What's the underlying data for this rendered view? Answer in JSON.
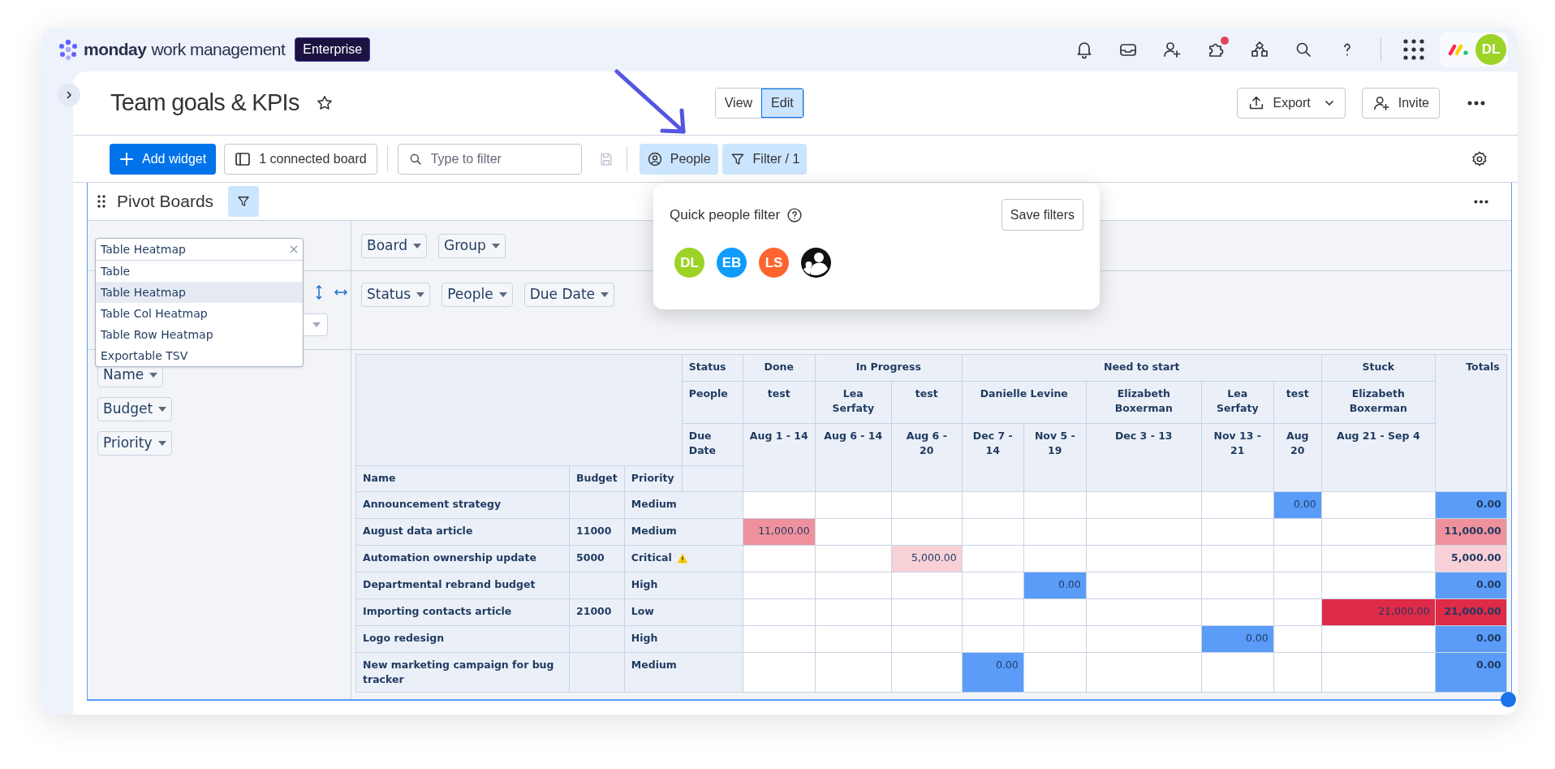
{
  "top_bar": {
    "brand": "monday",
    "product": "work management",
    "plan_badge": "Enterprise",
    "apps_notification": true,
    "avatar": {
      "initials": "DL",
      "color": "#9cd326"
    }
  },
  "board": {
    "title": "Team goals & KPIs",
    "view_modes": [
      {
        "label": "View",
        "selected": false
      },
      {
        "label": "Edit",
        "selected": true
      }
    ],
    "export_button": "Export",
    "invite_button": "Invite"
  },
  "toolbar": {
    "add_widget": "Add widget",
    "connected_boards": "1 connected board",
    "search": {
      "placeholder": "Type to filter"
    },
    "filters": [
      {
        "label": "People",
        "kind": "people",
        "active": true
      },
      {
        "label": "Filter / 1",
        "kind": "filter",
        "active": true
      }
    ]
  },
  "widget": {
    "title": "Pivot Boards",
    "renderer_select": {
      "value": "Table Heatmap",
      "options": [
        {
          "label": "Table",
          "selected": false
        },
        {
          "label": "Table Heatmap",
          "selected": true
        },
        {
          "label": "Table Col Heatmap",
          "selected": false
        },
        {
          "label": "Table Row Heatmap",
          "selected": false
        },
        {
          "label": "Exportable TSV",
          "selected": false
        }
      ]
    },
    "unused_attributes": [
      "Board",
      "Group"
    ],
    "column_attributes": [
      "Status",
      "People",
      "Due Date"
    ],
    "row_attributes": [
      "Name",
      "Budget",
      "Priority"
    ],
    "table": {
      "column_header_labels": [
        "Status",
        "People",
        "Due Date"
      ],
      "status_groups": [
        {
          "label": "Done",
          "people": [
            {
              "label": "test",
              "dates": [
                "Aug 1 - 14"
              ]
            }
          ]
        },
        {
          "label": "In Progress",
          "people": [
            {
              "label": "Lea Serfaty",
              "dates": [
                "Aug 6 - 14"
              ]
            },
            {
              "label": "test",
              "dates": [
                "Aug 6 - 20"
              ]
            }
          ]
        },
        {
          "label": "Need to start",
          "people": [
            {
              "label": "Danielle Levine",
              "dates": [
                "Dec 7 - 14",
                "Nov 5 - 19"
              ]
            },
            {
              "label": "Elizabeth Boxerman",
              "dates": [
                "Dec 3 - 13"
              ]
            },
            {
              "label": "Lea Serfaty",
              "dates": [
                "Nov 13 - 21"
              ]
            },
            {
              "label": "test",
              "dates": [
                "Aug 20"
              ]
            }
          ]
        },
        {
          "label": "Stuck",
          "people": [
            {
              "label": "Elizabeth Boxerman",
              "dates": [
                "Aug 21 - Sep 4"
              ]
            }
          ]
        }
      ],
      "totals_label": "Totals",
      "row_header_labels": [
        "Name",
        "Budget",
        "Priority"
      ],
      "rows": [
        {
          "name": "Announcement strategy",
          "priority": "Medium",
          "warning": false,
          "cells": [
            {
              "filled": false
            },
            {
              "filled": false
            },
            {
              "filled": false
            },
            {
              "filled": false
            },
            {
              "filled": false
            },
            {
              "filled": false
            },
            {
              "filled": false
            },
            {
              "filled": true,
              "text": "0.00",
              "color": "#5a9cf8"
            },
            {
              "filled": false
            }
          ],
          "total": {
            "text": "0.00",
            "color": "#5a9cf8"
          }
        },
        {
          "name": "August data article",
          "budget": "11000",
          "priority": "Medium",
          "warning": false,
          "cells": [
            {
              "filled": true,
              "text": "11,000.00",
              "color": "#ef919d"
            },
            {
              "filled": false
            },
            {
              "filled": false
            },
            {
              "filled": false
            },
            {
              "filled": false
            },
            {
              "filled": false
            },
            {
              "filled": false
            },
            {
              "filled": false
            },
            {
              "filled": false
            }
          ],
          "total": {
            "text": "11,000.00",
            "color": "#ef919d"
          }
        },
        {
          "name": "Automation ownership update",
          "budget": "5000",
          "priority": "Critical",
          "warning": true,
          "cells": [
            {
              "filled": false
            },
            {
              "filled": false
            },
            {
              "filled": true,
              "text": "5,000.00",
              "color": "#f8d1d7"
            },
            {
              "filled": false
            },
            {
              "filled": false
            },
            {
              "filled": false
            },
            {
              "filled": false
            },
            {
              "filled": false
            },
            {
              "filled": false
            }
          ],
          "total": {
            "text": "5,000.00",
            "color": "#f8d1d7"
          }
        },
        {
          "name": "Departmental rebrand budget",
          "priority": "High",
          "warning": false,
          "cells": [
            {
              "filled": false
            },
            {
              "filled": false
            },
            {
              "filled": false
            },
            {
              "filled": false
            },
            {
              "filled": true,
              "text": "0.00",
              "color": "#5a9cf8"
            },
            {
              "filled": false
            },
            {
              "filled": false
            },
            {
              "filled": false
            },
            {
              "filled": false
            }
          ],
          "total": {
            "text": "0.00",
            "color": "#5a9cf8"
          }
        },
        {
          "name": "Importing contacts article",
          "budget": "21000",
          "priority": "Low",
          "warning": false,
          "cells": [
            {
              "filled": false
            },
            {
              "filled": false
            },
            {
              "filled": false
            },
            {
              "filled": false
            },
            {
              "filled": false
            },
            {
              "filled": false
            },
            {
              "filled": false
            },
            {
              "filled": false
            },
            {
              "filled": true,
              "text": "21,000.00",
              "color": "#df2a48"
            }
          ],
          "total": {
            "text": "21,000.00",
            "color": "#df2a48"
          }
        },
        {
          "name": "Logo redesign",
          "priority": "High",
          "warning": false,
          "cells": [
            {
              "filled": false
            },
            {
              "filled": false
            },
            {
              "filled": false
            },
            {
              "filled": false
            },
            {
              "filled": false
            },
            {
              "filled": false
            },
            {
              "filled": true,
              "text": "0.00",
              "color": "#5a9cf8"
            },
            {
              "filled": false
            },
            {
              "filled": false
            }
          ],
          "total": {
            "text": "0.00",
            "color": "#5a9cf8"
          }
        },
        {
          "name": "New marketing campaign for bug tracker",
          "priority": "Medium",
          "warning": false,
          "cells": [
            {
              "filled": false
            },
            {
              "filled": false
            },
            {
              "filled": false
            },
            {
              "filled": true,
              "text": "0.00",
              "color": "#5a9cf8"
            },
            {
              "filled": false
            },
            {
              "filled": false
            },
            {
              "filled": false
            },
            {
              "filled": false
            },
            {
              "filled": false
            }
          ],
          "total": {
            "text": "0.00",
            "color": "#5a9cf8"
          }
        }
      ]
    }
  },
  "people_filter_popover": {
    "title": "Quick people filter",
    "save_button": "Save filters",
    "people": [
      {
        "kind": "person",
        "initials": "DL",
        "color": "#9cd326"
      },
      {
        "kind": "person",
        "initials": "EB",
        "color": "#0f9dfd"
      },
      {
        "kind": "person",
        "initials": "LS",
        "color": "#ff642e"
      },
      {
        "kind": "team"
      }
    ]
  }
}
